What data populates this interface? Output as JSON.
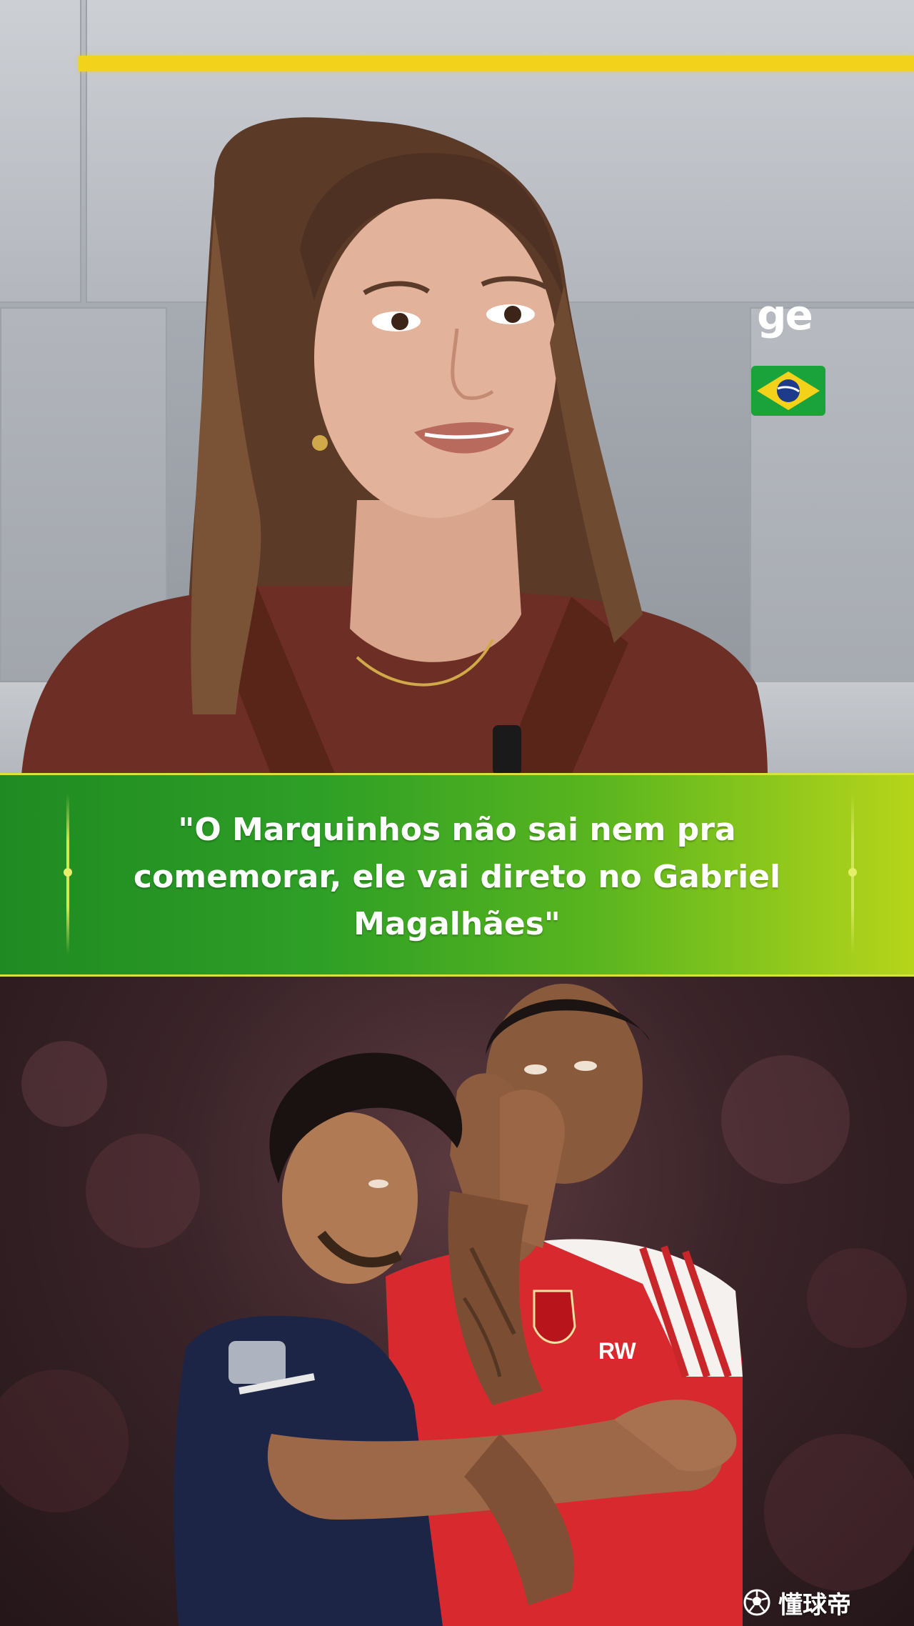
{
  "studio": {
    "channel_logo": "ge",
    "flag": "brazil-flag-icon"
  },
  "quote": {
    "text": "\"O Marquinhos não sai nem pra comemorar, ele vai direto no Gabriel Magalhães\""
  },
  "photo": {
    "shirt_text": "RW"
  },
  "watermark": {
    "text": "懂球帝",
    "icon": "soccer-ball-icon"
  },
  "colors": {
    "banner_start": "#1f8a22",
    "banner_end": "#b6d51a",
    "accent_yellow": "#f2d21a"
  }
}
